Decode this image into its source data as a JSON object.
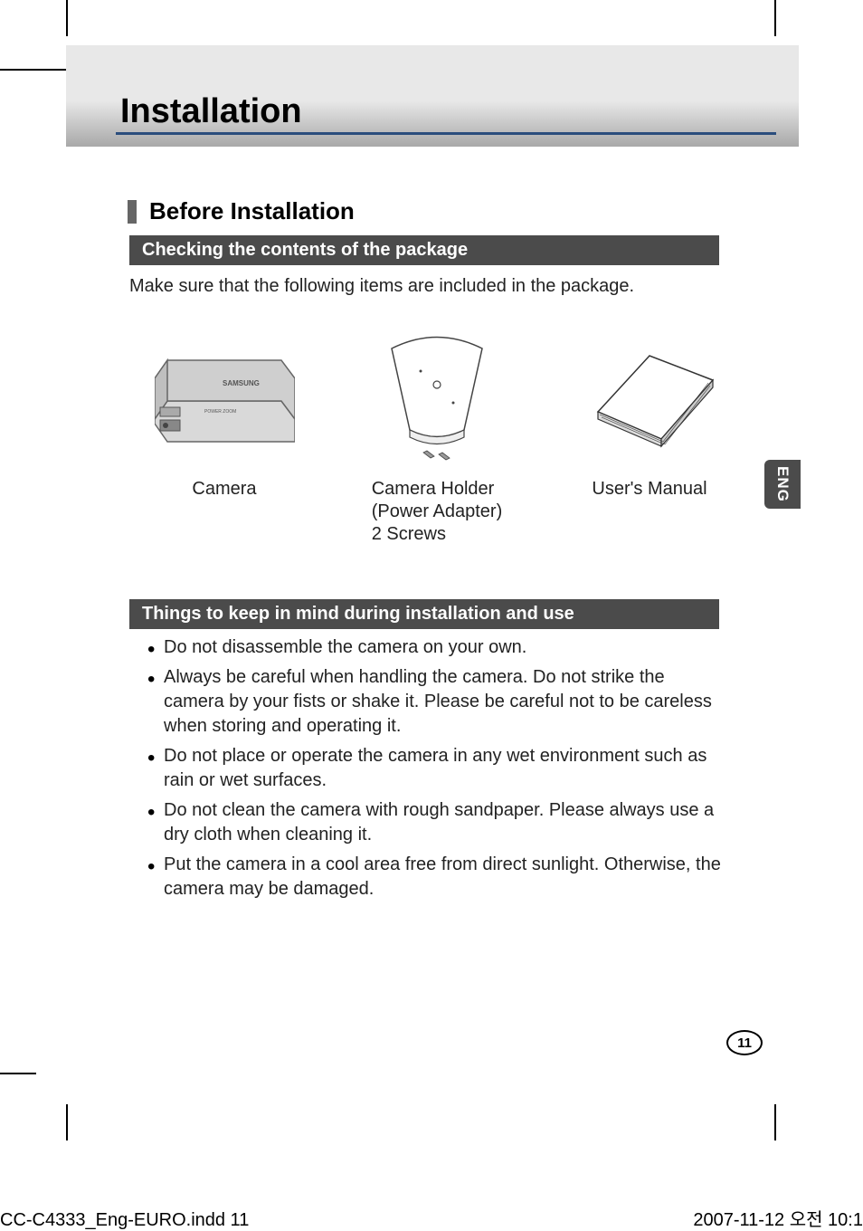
{
  "title": "Installation",
  "section": "Before Installation",
  "sub1": "Checking the contents of the package",
  "intro": "Make sure that the following items are included in the package.",
  "items": {
    "camera": "Camera",
    "holder": "Camera Holder\n(Power Adapter)\n2 Screws",
    "manual": "User's Manual"
  },
  "sub2": "Things to keep in mind during installation and use",
  "tips": [
    "Do not disassemble the camera on your own.",
    "Always be careful when handling the camera. Do not strike the camera by your fists or shake it. Please be careful not to be careless when storing and operating it.",
    "Do not place or operate the camera in any wet environment such as rain or wet surfaces.",
    "Do not clean the camera with rough sandpaper. Please always use a dry cloth when cleaning it.",
    "Put the camera in a cool area free from direct sunlight. Otherwise, the camera may be damaged."
  ],
  "lang_tab": "ENG",
  "page_num": "11",
  "footer_left": "CC-C4333_Eng-EURO.indd   11",
  "footer_right": "2007-11-12   오전 10:1"
}
